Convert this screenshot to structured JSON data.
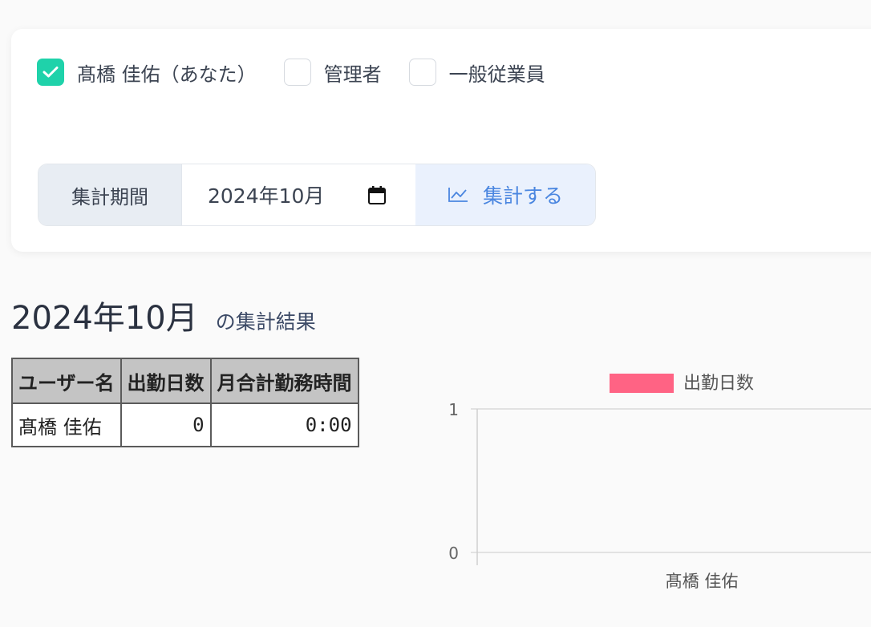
{
  "filters": [
    {
      "label": "髙橋 佳佑（あなた）",
      "checked": true
    },
    {
      "label": "管理者",
      "checked": false
    },
    {
      "label": "一般従業員",
      "checked": false
    }
  ],
  "period": {
    "label": "集計期間",
    "value": "2024年10月",
    "button_label": "集計する"
  },
  "result": {
    "month": "2024年10月",
    "suffix": "の集計結果"
  },
  "table": {
    "headers": [
      "ユーザー名",
      "出勤日数",
      "月合計勤務時間"
    ],
    "rows": [
      [
        "髙橋 佳佑",
        "0",
        "0:00"
      ]
    ]
  },
  "colors": {
    "check": "#1fd2aa",
    "accent": "#4a86e0",
    "bar": "#ff6384"
  },
  "chart_data": {
    "type": "bar",
    "categories": [
      "髙橋 佳佑"
    ],
    "series": [
      {
        "name": "出勤日数",
        "values": [
          0
        ]
      }
    ],
    "ylim": [
      0,
      1
    ],
    "yticks": [
      "0",
      "1"
    ],
    "legend": "top",
    "grid": true
  }
}
